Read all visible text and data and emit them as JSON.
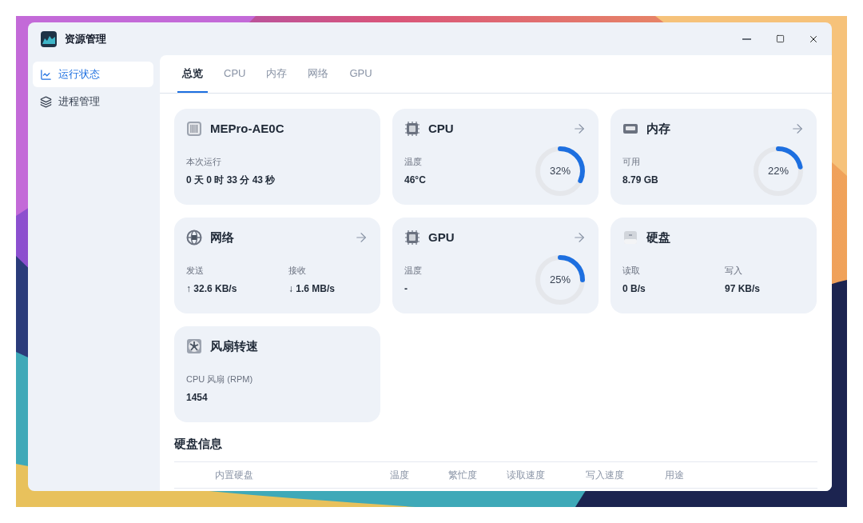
{
  "window": {
    "title": "资源管理"
  },
  "sidebar": {
    "items": [
      {
        "label": "运行状态",
        "selected": true,
        "kind": "chart"
      },
      {
        "label": "进程管理",
        "selected": false,
        "kind": "layers"
      }
    ]
  },
  "tabs": [
    {
      "label": "总览",
      "selected": true
    },
    {
      "label": "CPU",
      "selected": false
    },
    {
      "label": "内存",
      "selected": false
    },
    {
      "label": "网络",
      "selected": false
    },
    {
      "label": "GPU",
      "selected": false
    }
  ],
  "cards": [
    {
      "kind": "system",
      "title": "MEPro-AE0C",
      "link": false,
      "fields": [
        {
          "label": "本次运行",
          "value": "0 天 0 时 33 分 43 秒"
        }
      ]
    },
    {
      "kind": "cpu",
      "title": "CPU",
      "link": true,
      "fields": [
        {
          "label": "温度",
          "value": "46°C"
        }
      ],
      "gauge": {
        "level": 0.32,
        "reading": "32%"
      }
    },
    {
      "kind": "memory",
      "title": "内存",
      "link": true,
      "fields": [
        {
          "label": "可用",
          "value": "8.79 GB"
        }
      ],
      "gauge": {
        "level": 0.22,
        "reading": "22%"
      }
    },
    {
      "kind": "network",
      "title": "网络",
      "link": true,
      "fields": [
        {
          "label": "发送",
          "value": "↑ 32.6 KB/s"
        },
        {
          "label": "接收",
          "value": "↓ 1.6 MB/s"
        }
      ]
    },
    {
      "kind": "gpu",
      "title": "GPU",
      "link": true,
      "fields": [
        {
          "label": "温度",
          "value": "-"
        }
      ],
      "gauge": {
        "level": 0.25,
        "reading": "25%"
      }
    },
    {
      "kind": "disk",
      "title": "硬盘",
      "link": false,
      "fields": [
        {
          "label": "读取",
          "value": "0 B/s"
        },
        {
          "label": "写入",
          "value": "97 KB/s"
        }
      ]
    },
    {
      "kind": "fan",
      "title": "风扇转速",
      "link": false,
      "fields": [
        {
          "label": "CPU 风扇 (RPM)",
          "value": "1454"
        }
      ]
    }
  ],
  "disk_info": {
    "title": "硬盘信息",
    "columns": [
      "内置硬盘",
      "温度",
      "繁忙度",
      "读取速度",
      "写入速度",
      "用途"
    ]
  }
}
